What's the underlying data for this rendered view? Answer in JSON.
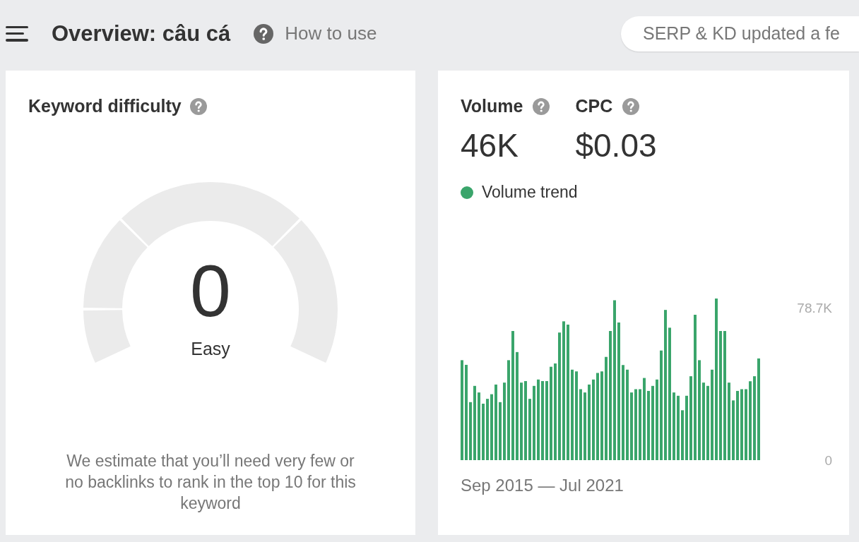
{
  "header": {
    "title": "Overview: câu cá",
    "help_link": "How to use",
    "status_pill": "SERP & KD updated a fe"
  },
  "difficulty_card": {
    "title": "Keyword difficulty",
    "score": "0",
    "rating": "Easy",
    "description": "We estimate that you’ll need very few or no backlinks to rank in the top 10 for this keyword"
  },
  "volume_card": {
    "metrics": [
      {
        "label": "Volume",
        "value": "46K"
      },
      {
        "label": "CPC",
        "value": "$0.03"
      }
    ],
    "chart_data": {
      "type": "bar",
      "ylim": [
        0,
        83.6
      ],
      "yticks": [
        {
          "value": 0,
          "label": "0"
        },
        {
          "value": 78.7,
          "label": "78.7K"
        }
      ],
      "series": [
        {
          "name": "Volume trend",
          "color": "#3aa56b",
          "values": [
            51.7,
            49.3,
            30.0,
            38.4,
            35.0,
            29.2,
            31.7,
            34.1,
            39.1,
            30.0,
            40.1,
            51.7,
            66.8,
            55.9,
            40.1,
            40.9,
            31.7,
            38.4,
            41.7,
            40.9,
            40.9,
            48.3,
            50.0,
            66.0,
            71.8,
            70.1,
            46.8,
            45.9,
            36.7,
            35.0,
            39.1,
            41.7,
            45.1,
            45.9,
            53.4,
            66.8,
            82.7,
            71.2,
            49.2,
            46.8,
            35.0,
            36.7,
            36.7,
            42.5,
            35.8,
            38.4,
            41.7,
            56.7,
            77.7,
            68.5,
            35.0,
            33.3,
            25.8,
            33.3,
            43.4,
            75.2,
            51.7,
            40.1,
            38.4,
            46.8,
            83.6,
            66.8,
            66.8,
            40.1,
            30.9,
            35.8,
            36.7,
            36.7,
            40.8,
            43.4,
            52.6
          ]
        }
      ]
    },
    "date_range": "Sep 2015 — Jul 2021"
  }
}
